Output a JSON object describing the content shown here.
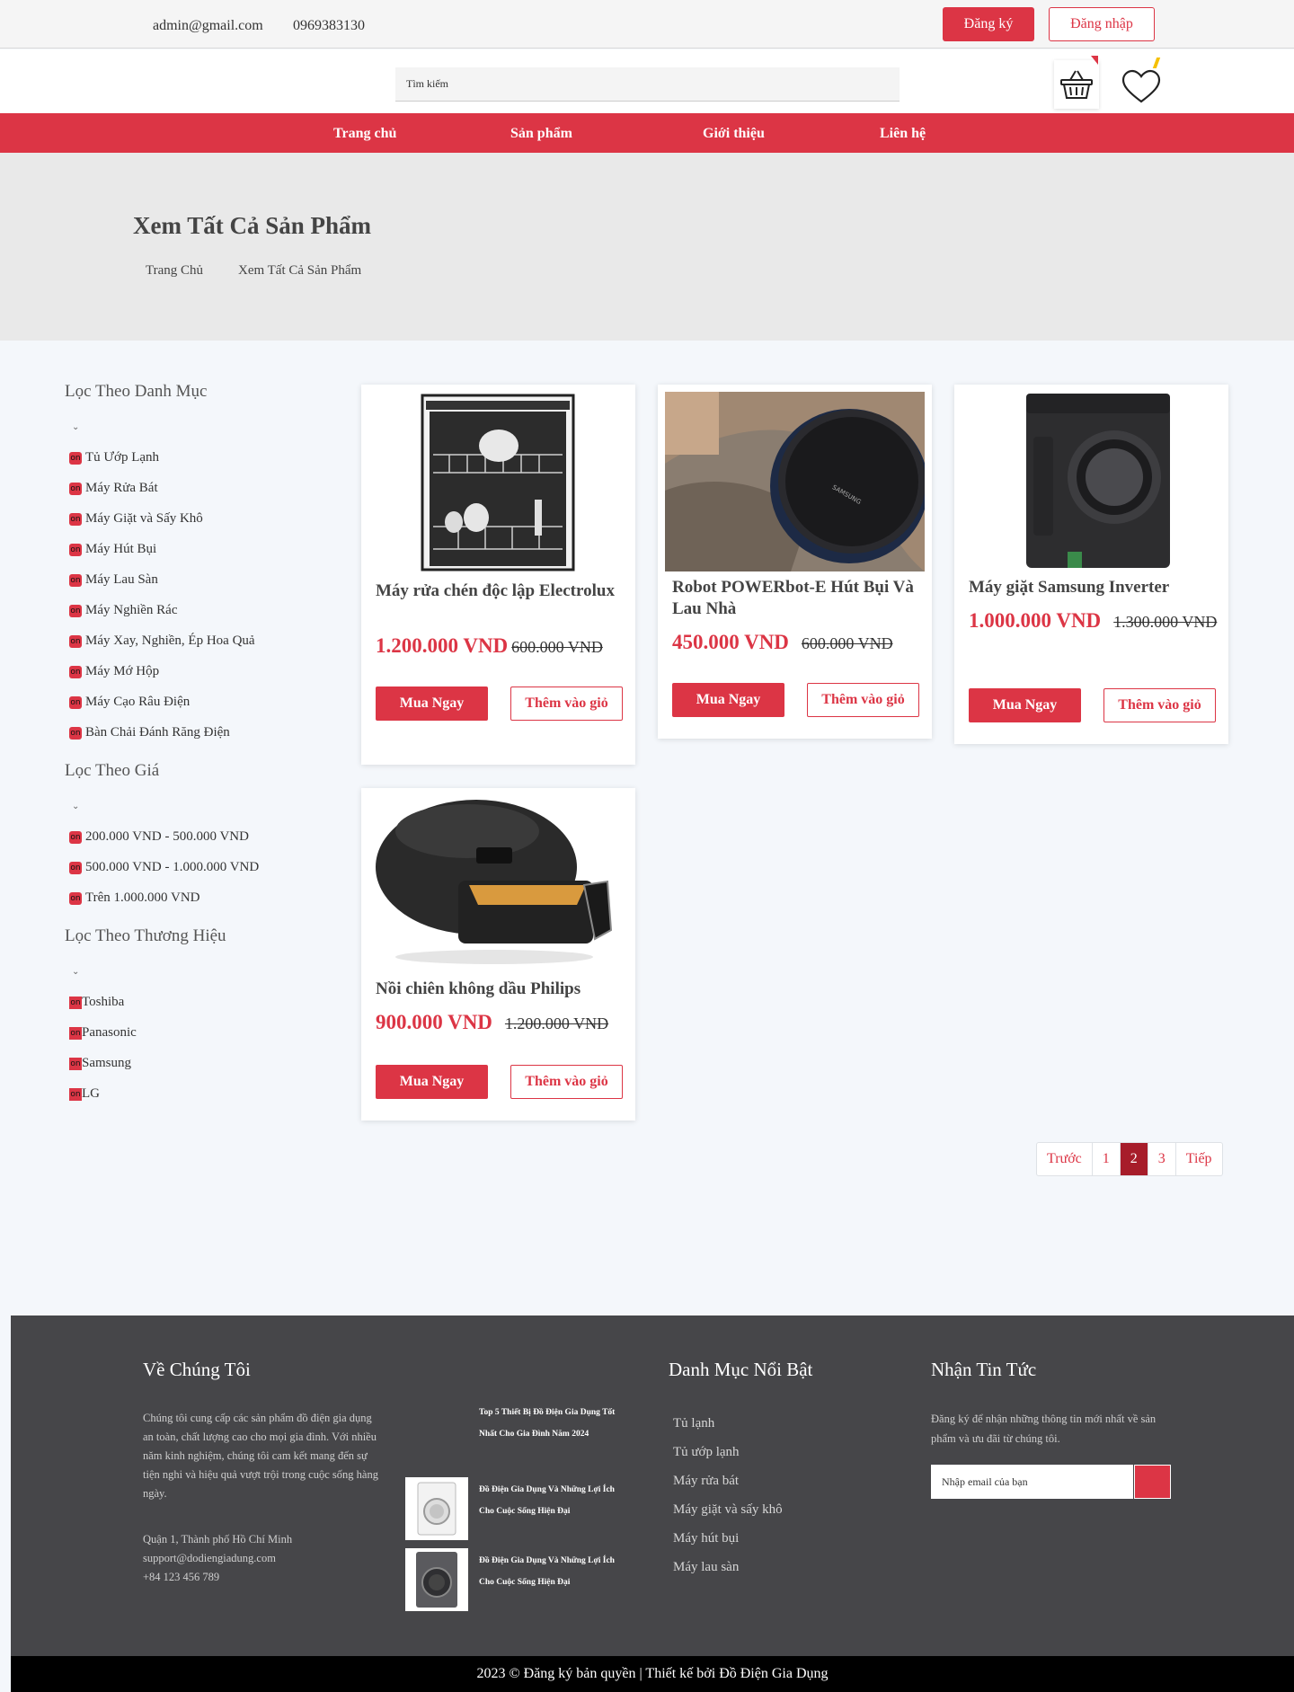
{
  "topbar": {
    "email": "admin@gmail.com",
    "phone": "0969383130",
    "register_label": "Đăng ký",
    "login_label": "Đăng nhập"
  },
  "header": {
    "search_placeholder": "Tìm kiếm",
    "cart_icon": "basket-icon",
    "wishlist_icon": "heart-icon"
  },
  "nav": {
    "items": [
      "Trang chủ",
      "Sản phẩm",
      "Giới thiệu",
      "Liên hệ"
    ]
  },
  "banner": {
    "title": "Xem Tất Cả Sản Phẩm",
    "breadcrumb": [
      "Trang Chủ",
      "Xem Tất Cả Sản Phẩm"
    ]
  },
  "filters": {
    "check_glyph": "on",
    "caret_glyph": "⌄",
    "category": {
      "title": "Lọc Theo Danh Mục",
      "items": [
        "Tủ Ướp Lạnh",
        "Máy Rửa Bát",
        "Máy Giặt và Sấy Khô",
        "Máy Hút Bụi",
        "Máy Lau Sàn",
        "Máy Nghiền Rác",
        "Máy Xay, Nghiền, Ép Hoa Quả",
        "Máy Mớ Hộp",
        "Máy Cạo Râu Điện",
        "Bàn Chải Đánh Răng Điện"
      ]
    },
    "price": {
      "title": "Lọc Theo Giá",
      "items": [
        "200.000 VND - 500.000 VND",
        "500.000 VND - 1.000.000 VND",
        "Trên 1.000.000 VND"
      ]
    },
    "brand": {
      "title": "Lọc Theo Thương Hiệu",
      "items": [
        "Toshiba",
        "Panasonic",
        "Samsung",
        "LG"
      ]
    }
  },
  "products": [
    {
      "name": "Máy rửa chén độc lập Electrolux",
      "price": "1.200.000 VND",
      "old_price": "600.000 VND",
      "image": "dishwasher-image"
    },
    {
      "name": "Robot POWERbot-E Hút Bụi Và Lau Nhà",
      "price": "450.000 VND",
      "old_price": "600.000 VND",
      "image": "robot-vacuum-image"
    },
    {
      "name": "Máy giặt Samsung Inverter",
      "price": "1.000.000 VND",
      "old_price": "1.300.000 VND",
      "image": "washing-machine-image"
    },
    {
      "name": "Nồi chiên không dầu Philips",
      "price": "900.000 VND",
      "old_price": "1.200.000 VND",
      "image": "air-fryer-image"
    }
  ],
  "product_buttons": {
    "buy": "Mua Ngay",
    "add": "Thêm vào giỏ"
  },
  "pagination": {
    "prev": "Trước",
    "pages": [
      "1",
      "2",
      "3"
    ],
    "current": "2",
    "next": "Tiếp"
  },
  "footer": {
    "about_title": "Về Chúng Tôi",
    "about_text": "Chúng tôi cung cấp các sản phẩm đồ điện gia dụng an toàn, chất lượng cao cho mọi gia đình. Với nhiều năm kinh nghiệm, chúng tôi cam kết mang đến sự tiện nghi và hiệu quả vượt trội trong cuộc sống hàng ngày.",
    "address": "Quận 1, Thành phố Hồ Chí Minh",
    "email": "support@dodiengiadung.com",
    "phone": "+84 123 456 789",
    "posts": [
      "Top 5 Thiết Bị Đồ Điện Gia Dụng Tốt Nhất Cho Gia Đình Năm 2024",
      "Đồ Điện Gia Dụng Và Những Lợi Ích Cho Cuộc Sống Hiện Đại",
      "Đồ Điện Gia Dụng Và Những Lợi Ích Cho Cuộc Sống Hiện Đại"
    ],
    "categories_title": "Danh Mục Nổi Bật",
    "categories": [
      "Tủ lạnh",
      "Tủ ướp lạnh",
      "Máy rửa bát",
      "Máy giặt và sấy khô",
      "Máy hút bụi",
      "Máy lau sàn"
    ],
    "news_title": "Nhận Tin Tức",
    "news_text": "Đăng ký để nhận những thông tin mới nhất về sản phẩm và ưu đãi từ chúng tôi.",
    "email_placeholder": "Nhập email của bạn",
    "copyright": "2023 © Đăng ký bản quyền | Thiết kế bởi Đồ Điện Gia Dụng"
  },
  "colors": {
    "accent": "#dc3545",
    "footer_bg": "#464649",
    "banner_bg": "#e9e9e9",
    "page_bg": "#f4f7fb"
  }
}
